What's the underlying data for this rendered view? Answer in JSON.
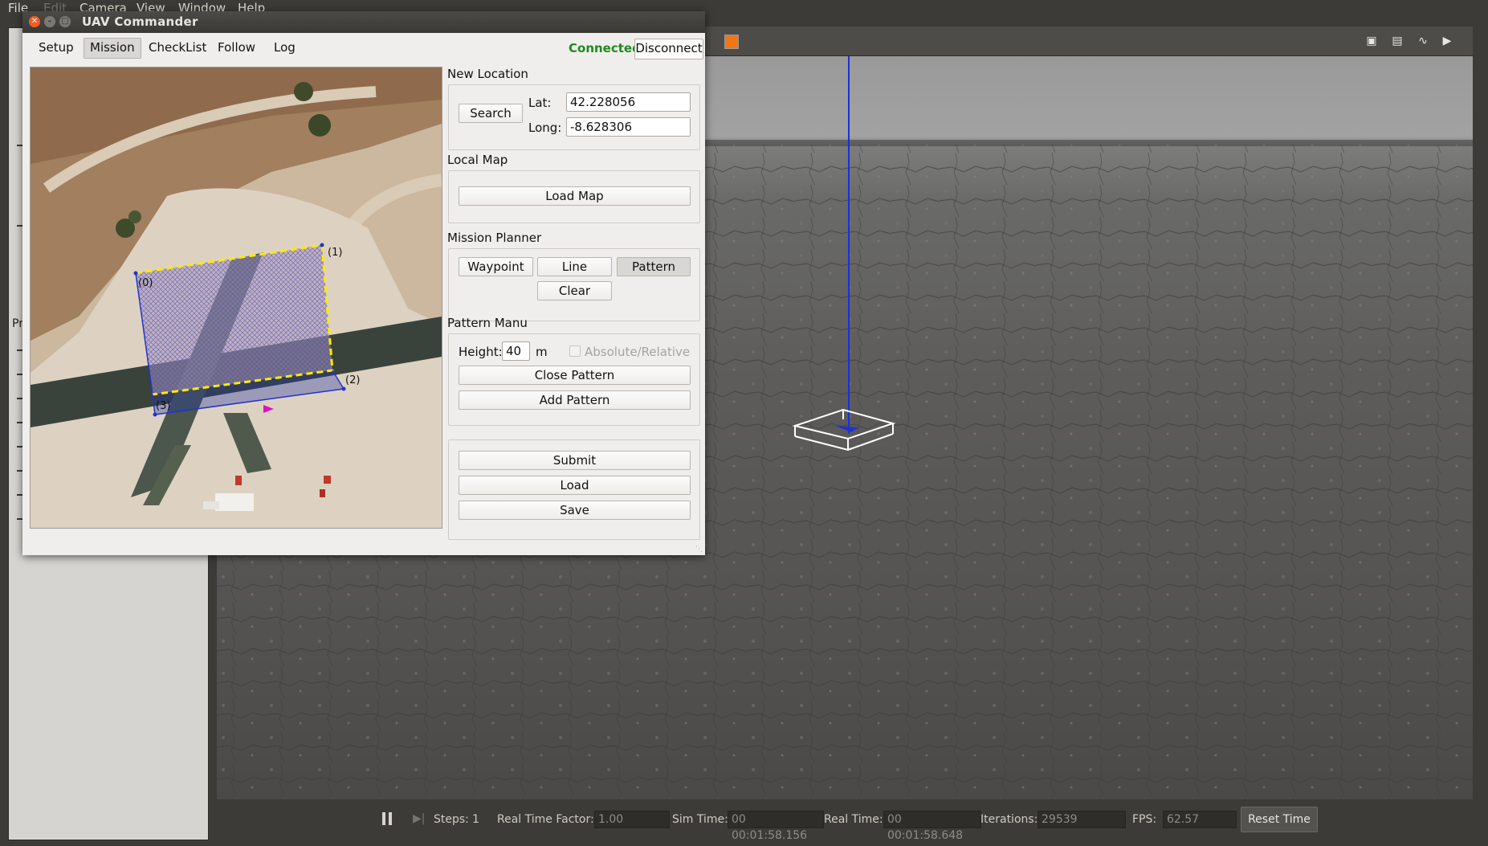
{
  "gazebo": {
    "menu": {
      "file": "File",
      "edit": "Edit",
      "camera": "Camera",
      "view": "View",
      "window": "Window",
      "help": "Help"
    },
    "left_panel_label": "Pr",
    "bottom_bar": {
      "steps_label": "Steps:",
      "steps_value": "1",
      "rtf_label": "Real Time Factor:",
      "rtf_value": "1.00",
      "sim_time_label": "Sim Time:",
      "sim_time_value": "00 00:01:58.156",
      "real_time_label": "Real Time:",
      "real_time_value": "00 00:01:58.648",
      "iterations_label": "Iterations:",
      "iterations_value": "29539",
      "fps_label": "FPS:",
      "fps_value": "62.57",
      "reset_time_label": "Reset Time"
    },
    "toolbar_icons": [
      "camera-icon",
      "log-icon",
      "plot-icon",
      "video-icon"
    ]
  },
  "uav": {
    "title": "UAV Commander",
    "tabs": [
      {
        "label": "Setup"
      },
      {
        "label": "Mission"
      },
      {
        "label": "CheckList"
      },
      {
        "label": "Follow"
      },
      {
        "label": "Log"
      }
    ],
    "active_tab": "Mission",
    "status": "Connected",
    "status_color": "#1f8a1f",
    "disconnect_label": "Disconnect",
    "map": {
      "points": [
        {
          "label": "(0)"
        },
        {
          "label": "(1)"
        },
        {
          "label": "(2)"
        },
        {
          "label": "(3)"
        }
      ]
    },
    "new_location": {
      "title": "New Location",
      "search_label": "Search",
      "lat_label": "Lat:",
      "lat_value": "42.228056",
      "long_label": "Long:",
      "long_value": "-8.628306"
    },
    "local_map": {
      "title": "Local Map",
      "load_map_label": "Load Map"
    },
    "mission_planner": {
      "title": "Mission Planner",
      "waypoint_label": "Waypoint",
      "line_label": "Line",
      "pattern_label": "Pattern",
      "clear_label": "Clear"
    },
    "pattern_manu": {
      "title": "Pattern Manu",
      "height_label": "Height:",
      "height_value": "40",
      "unit": "m",
      "absolute_relative_label": "Absolute/Relative",
      "close_pattern_label": "Close Pattern",
      "add_pattern_label": "Add Pattern"
    },
    "actions": {
      "submit_label": "Submit",
      "load_label": "Load",
      "save_label": "Save"
    }
  }
}
